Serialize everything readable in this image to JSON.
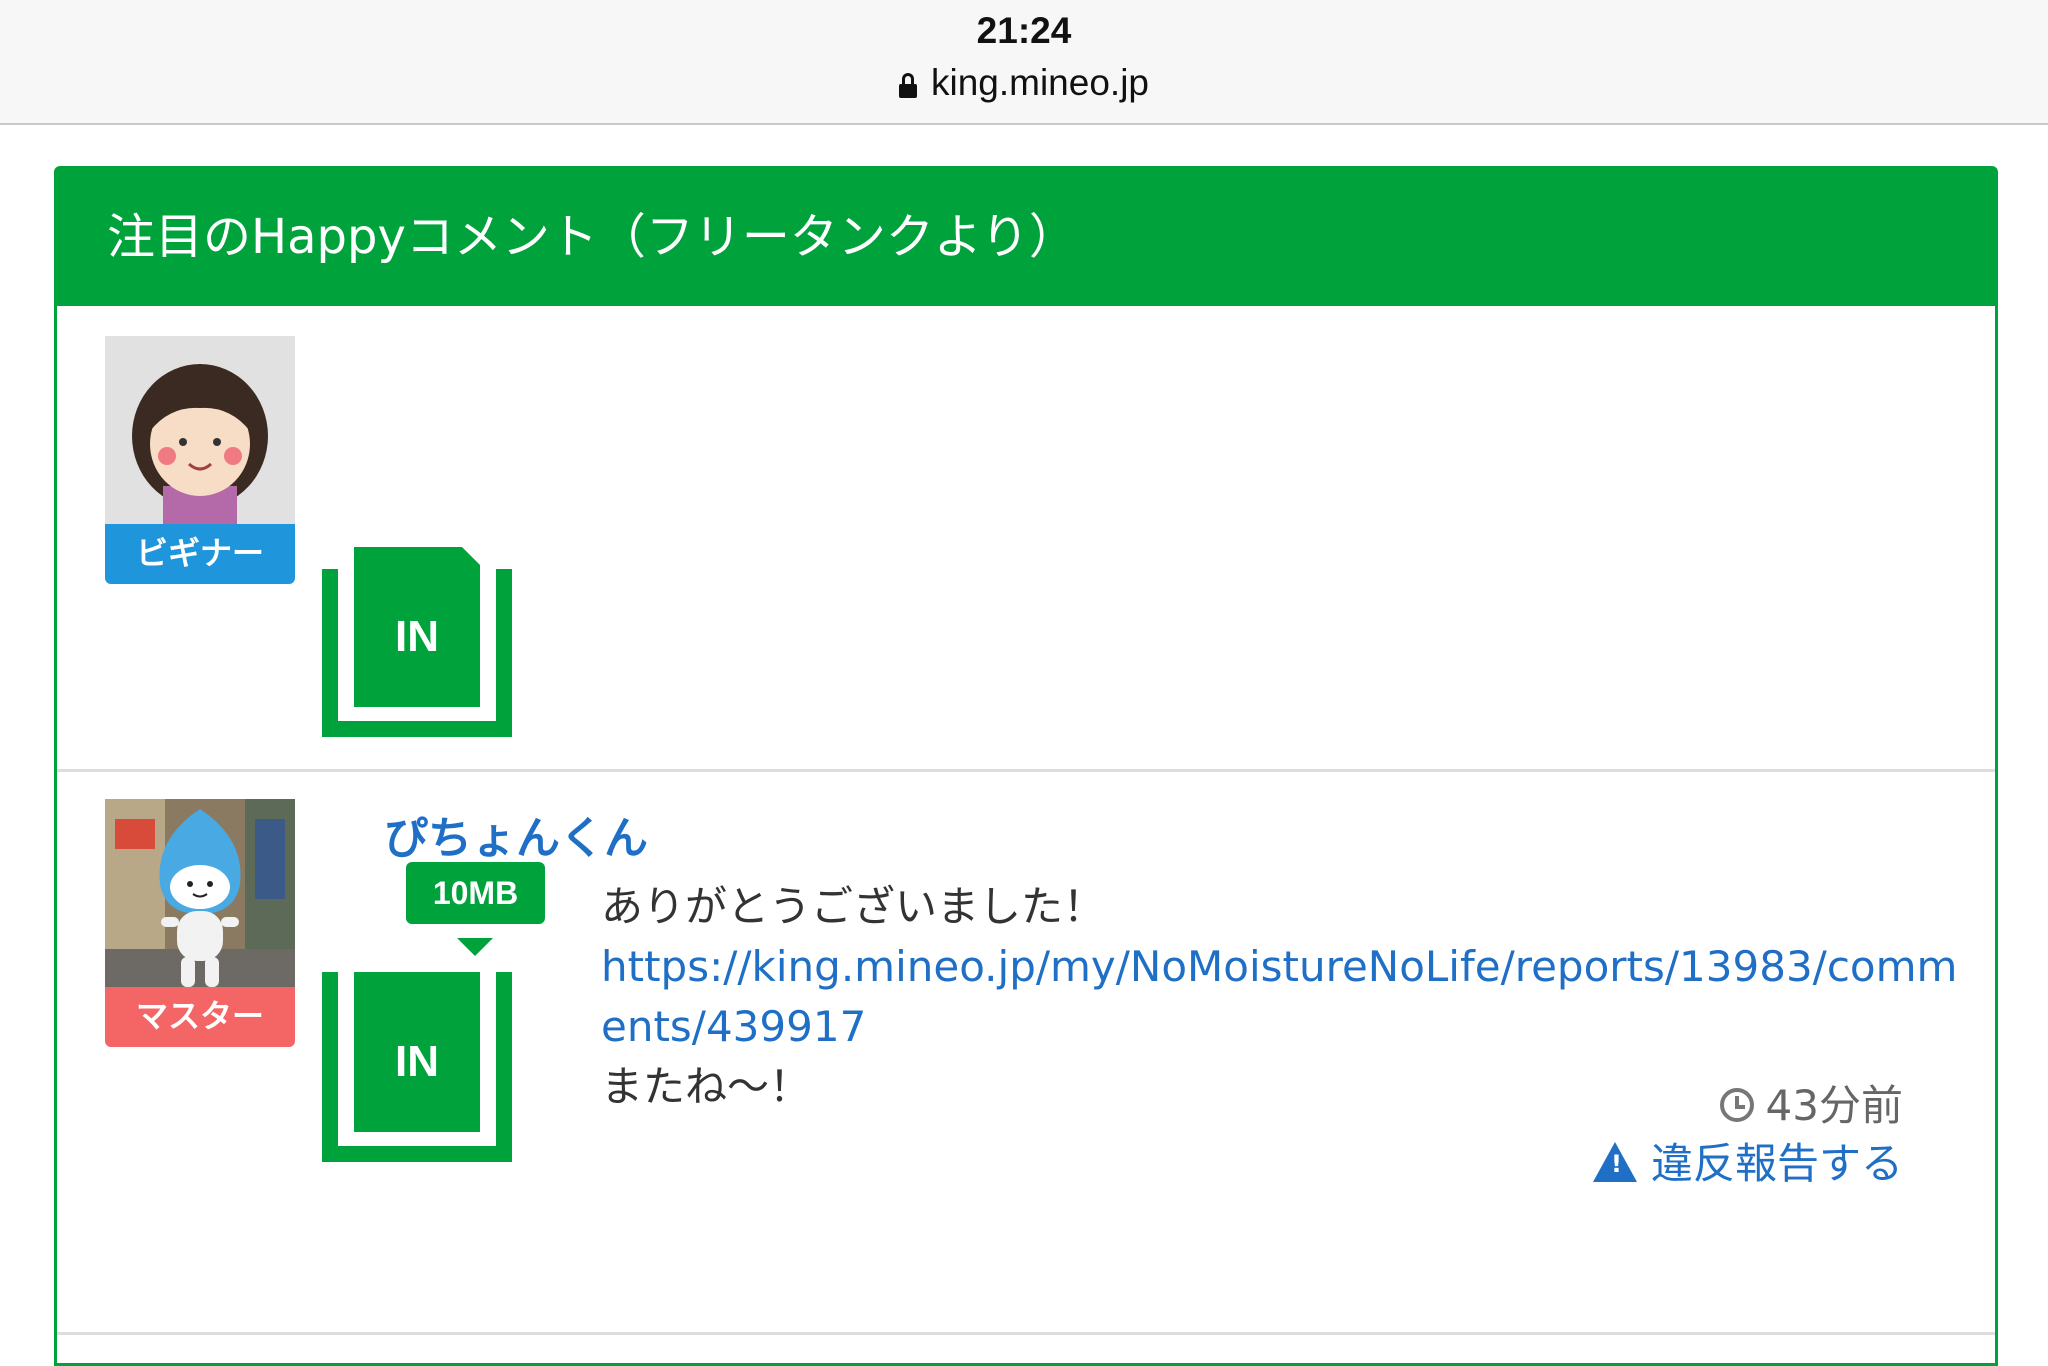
{
  "status_bar": {
    "time": "21:24",
    "url": "king.mineo.jp"
  },
  "panel": {
    "title": "注目のHappyコメント（フリータンクより）"
  },
  "entries": [
    {
      "rank": "ビギナー",
      "badge": "IN"
    },
    {
      "username": "ぴちょんくん",
      "amount": "10MB",
      "rank": "マスター",
      "badge": "IN",
      "comment_line1": "ありがとうございました！",
      "comment_link": "https://king.mineo.jp/my/NoMoistureNoLife/reports/13983/comments/439917",
      "comment_line2": "またね〜！",
      "time_ago": "43分前",
      "report_label": "違反報告する"
    }
  ],
  "colors": {
    "accent_green": "#00a23c",
    "link_blue": "#1e6fc5",
    "beginner_blue": "#1f95dc",
    "master_red": "#f46566"
  },
  "icons": [
    "lock-icon",
    "clock-icon",
    "warning-icon"
  ]
}
